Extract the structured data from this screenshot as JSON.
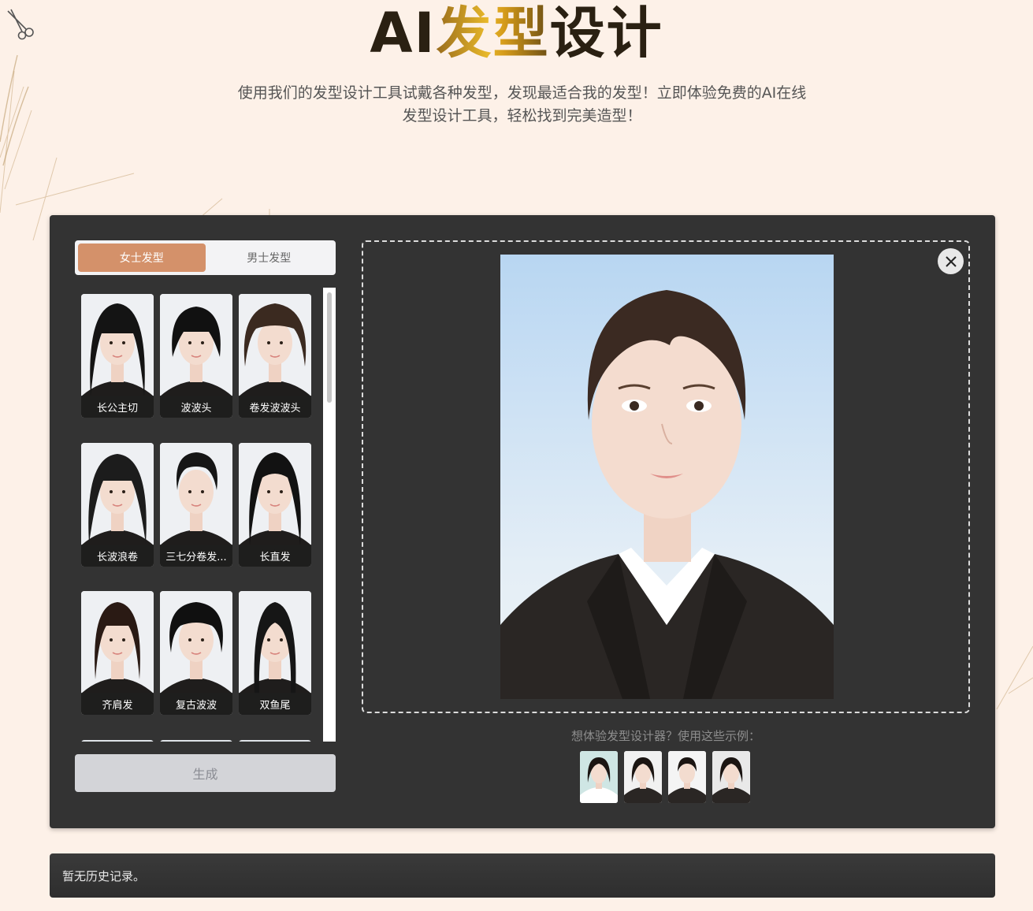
{
  "header": {
    "title_part1": "AI",
    "title_part2": "发型",
    "title_part3": "设计",
    "subtitle_line1": "使用我们的发型设计工具试戴各种发型，发现最适合我的发型！立即体验免费的AI在线",
    "subtitle_line2": "发型设计工具，轻松找到完美造型！",
    "decor_icon": "scissors-icon"
  },
  "tabs": [
    {
      "label": "女士发型",
      "active": true
    },
    {
      "label": "男士发型",
      "active": false
    }
  ],
  "hairstyles": [
    {
      "label": "长公主切",
      "hair": "#141414",
      "kind": "long-bangs"
    },
    {
      "label": "波波头",
      "hair": "#111111",
      "kind": "bob"
    },
    {
      "label": "卷发波波头",
      "hair": "#3b2a20",
      "kind": "curly"
    },
    {
      "label": "长波浪卷",
      "hair": "#1c1c1c",
      "kind": "wavy"
    },
    {
      "label": "三七分卷发...",
      "hair": "#161616",
      "kind": "short-curly"
    },
    {
      "label": "长直发",
      "hair": "#121212",
      "kind": "long-straight"
    },
    {
      "label": "齐肩发",
      "hair": "#2a1a14",
      "kind": "shoulder"
    },
    {
      "label": "复古波波",
      "hair": "#101010",
      "kind": "retro"
    },
    {
      "label": "双鱼尾",
      "hair": "#161616",
      "kind": "braids"
    }
  ],
  "generate_button": "生成",
  "preview": {
    "close_icon": "close-icon",
    "examples_prompt": "想体验发型设计器？使用这些示例：",
    "examples": [
      {
        "name": "example-woman-1",
        "bg": "#cfe6e4"
      },
      {
        "name": "example-woman-2",
        "bg": "#f1f1f1"
      },
      {
        "name": "example-man-1",
        "bg": "#f4f4f4"
      },
      {
        "name": "example-woman-3",
        "bg": "#e9e9e9"
      }
    ]
  },
  "history": {
    "empty_text": "暂无历史记录。"
  },
  "colors": {
    "page_bg": "#fdf1e8",
    "panel_bg": "#333333",
    "accent": "#d4916a",
    "title_gold": "#e8b82a"
  }
}
